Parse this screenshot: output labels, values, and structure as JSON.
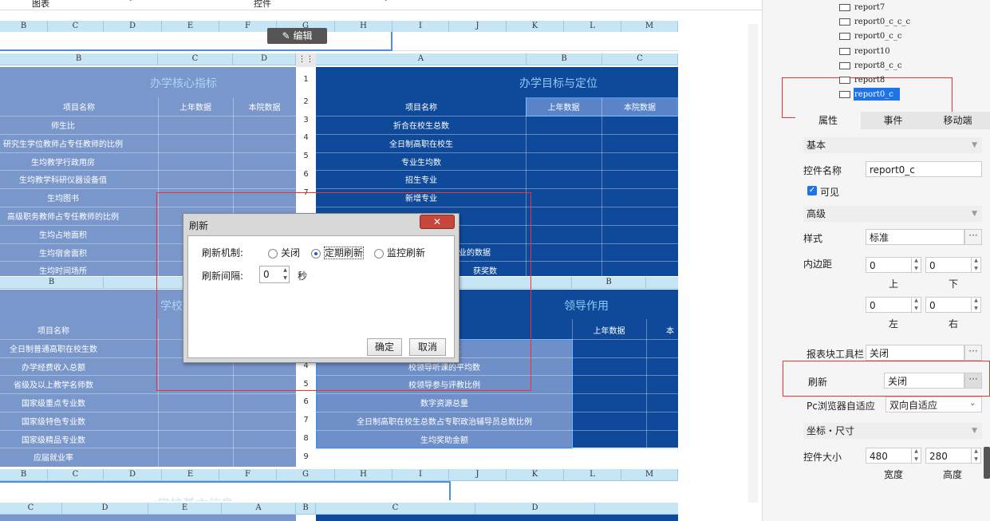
{
  "toolbar": {
    "dropdown1": "图表",
    "dropdown2": "控件"
  },
  "edit_button": "编辑",
  "top_headers": [
    "B",
    "C",
    "D",
    "E",
    "F",
    "G",
    "H",
    "I",
    "J",
    "K",
    "L",
    "M"
  ],
  "left_panel": {
    "col_headers": [
      "B",
      "C",
      "D"
    ],
    "title": "办学核心指标",
    "head": [
      "项目名称",
      "上年数据",
      "本院数据"
    ],
    "rows": [
      "师生比",
      "研究生学位教师占专任教师的比例",
      "生均教学行政用房",
      "生均教学科研仪器设备值",
      "生均图书",
      "高级职务教师占专任教师的比例",
      "生均占地面积",
      "生均宿舍面积",
      "生均时间场所"
    ]
  },
  "right_panel": {
    "col_headers": [
      "A",
      "B",
      "C"
    ],
    "row_numbers": [
      "1",
      "2",
      "3",
      "4",
      "5",
      "6",
      "7"
    ],
    "title": "办学目标与定位",
    "head": [
      "项目名称",
      "上年数据",
      "本院数据"
    ],
    "rows": [
      "折合在校生总数",
      "全日制高职在校生",
      "专业生均数",
      "招生专业",
      "新增专业"
    ],
    "partial1": "业的数据",
    "partial2": "获奖数"
  },
  "lower_left": {
    "col_header": "B",
    "title_partial": "学校",
    "head": "项目名称",
    "rows": [
      "全日制普通高职在校生数",
      "办学经费收入总额",
      "省级及以上教学名师数",
      "国家级重点专业数",
      "国家级特色专业数",
      "国家级精品专业数",
      "应届就业率"
    ]
  },
  "lower_right": {
    "col_header": "B",
    "title": "领导作用",
    "head": [
      "上年数据",
      "本"
    ],
    "row_numbers": [
      "4",
      "5",
      "6",
      "7",
      "8",
      "9"
    ],
    "rows": [
      "师平均数",
      "校领导听课的平均数",
      "校领导参与评教比例",
      "数字资源总量",
      "全日制高职在校生总数占专职政治辅导员总数比例",
      "生均奖助金额"
    ]
  },
  "bottom_headers": [
    "B",
    "C",
    "D",
    "E",
    "F",
    "G",
    "H",
    "I",
    "J",
    "K",
    "L",
    "M"
  ],
  "bottom_row2": [
    "C",
    "D",
    "E",
    "A",
    "B",
    "C",
    "D"
  ],
  "bottom_title_partial": "学校基本信息",
  "dialog": {
    "title": "刷新",
    "mechanism_label": "刷新机制:",
    "options": [
      "关闭",
      "定期刷新",
      "监控刷新"
    ],
    "selected": "定期刷新",
    "interval_label": "刷新间隔:",
    "interval_value": "0",
    "interval_unit": "秒",
    "ok": "确定",
    "cancel": "取消"
  },
  "tree": [
    "report7",
    "report0_c_c_c",
    "report0_c_c",
    "report10",
    "report8_c_c",
    "report8",
    "report0_c"
  ],
  "tabs": [
    "属性",
    "事件",
    "移动端"
  ],
  "props": {
    "basic": "基本",
    "widget_name_label": "控件名称",
    "widget_name": "report0_c",
    "visible_label": "可见",
    "advanced": "高级",
    "style_label": "样式",
    "style_value": "标准",
    "padding_label": "内边距",
    "pad_top": "0",
    "pad_bottom": "0",
    "pad_left": "0",
    "pad_right": "0",
    "top": "上",
    "bottom": "下",
    "left": "左",
    "right": "右",
    "toolbar_label": "报表块工具栏",
    "toolbar_value": "关闭",
    "refresh_label": "刷新",
    "refresh_value": "关闭",
    "pc_label": "Pc浏览器自适应",
    "pc_value": "双向自适应",
    "coord": "坐标・尺寸",
    "size_label": "控件大小",
    "width": "480",
    "height": "280",
    "width_label": "宽度",
    "height_label": "高度"
  },
  "colors": {
    "dark_blue": "#0f4a9a",
    "light_blue": "#7a97cc",
    "header": "#c7e6f5",
    "highlight": "#e33333"
  }
}
